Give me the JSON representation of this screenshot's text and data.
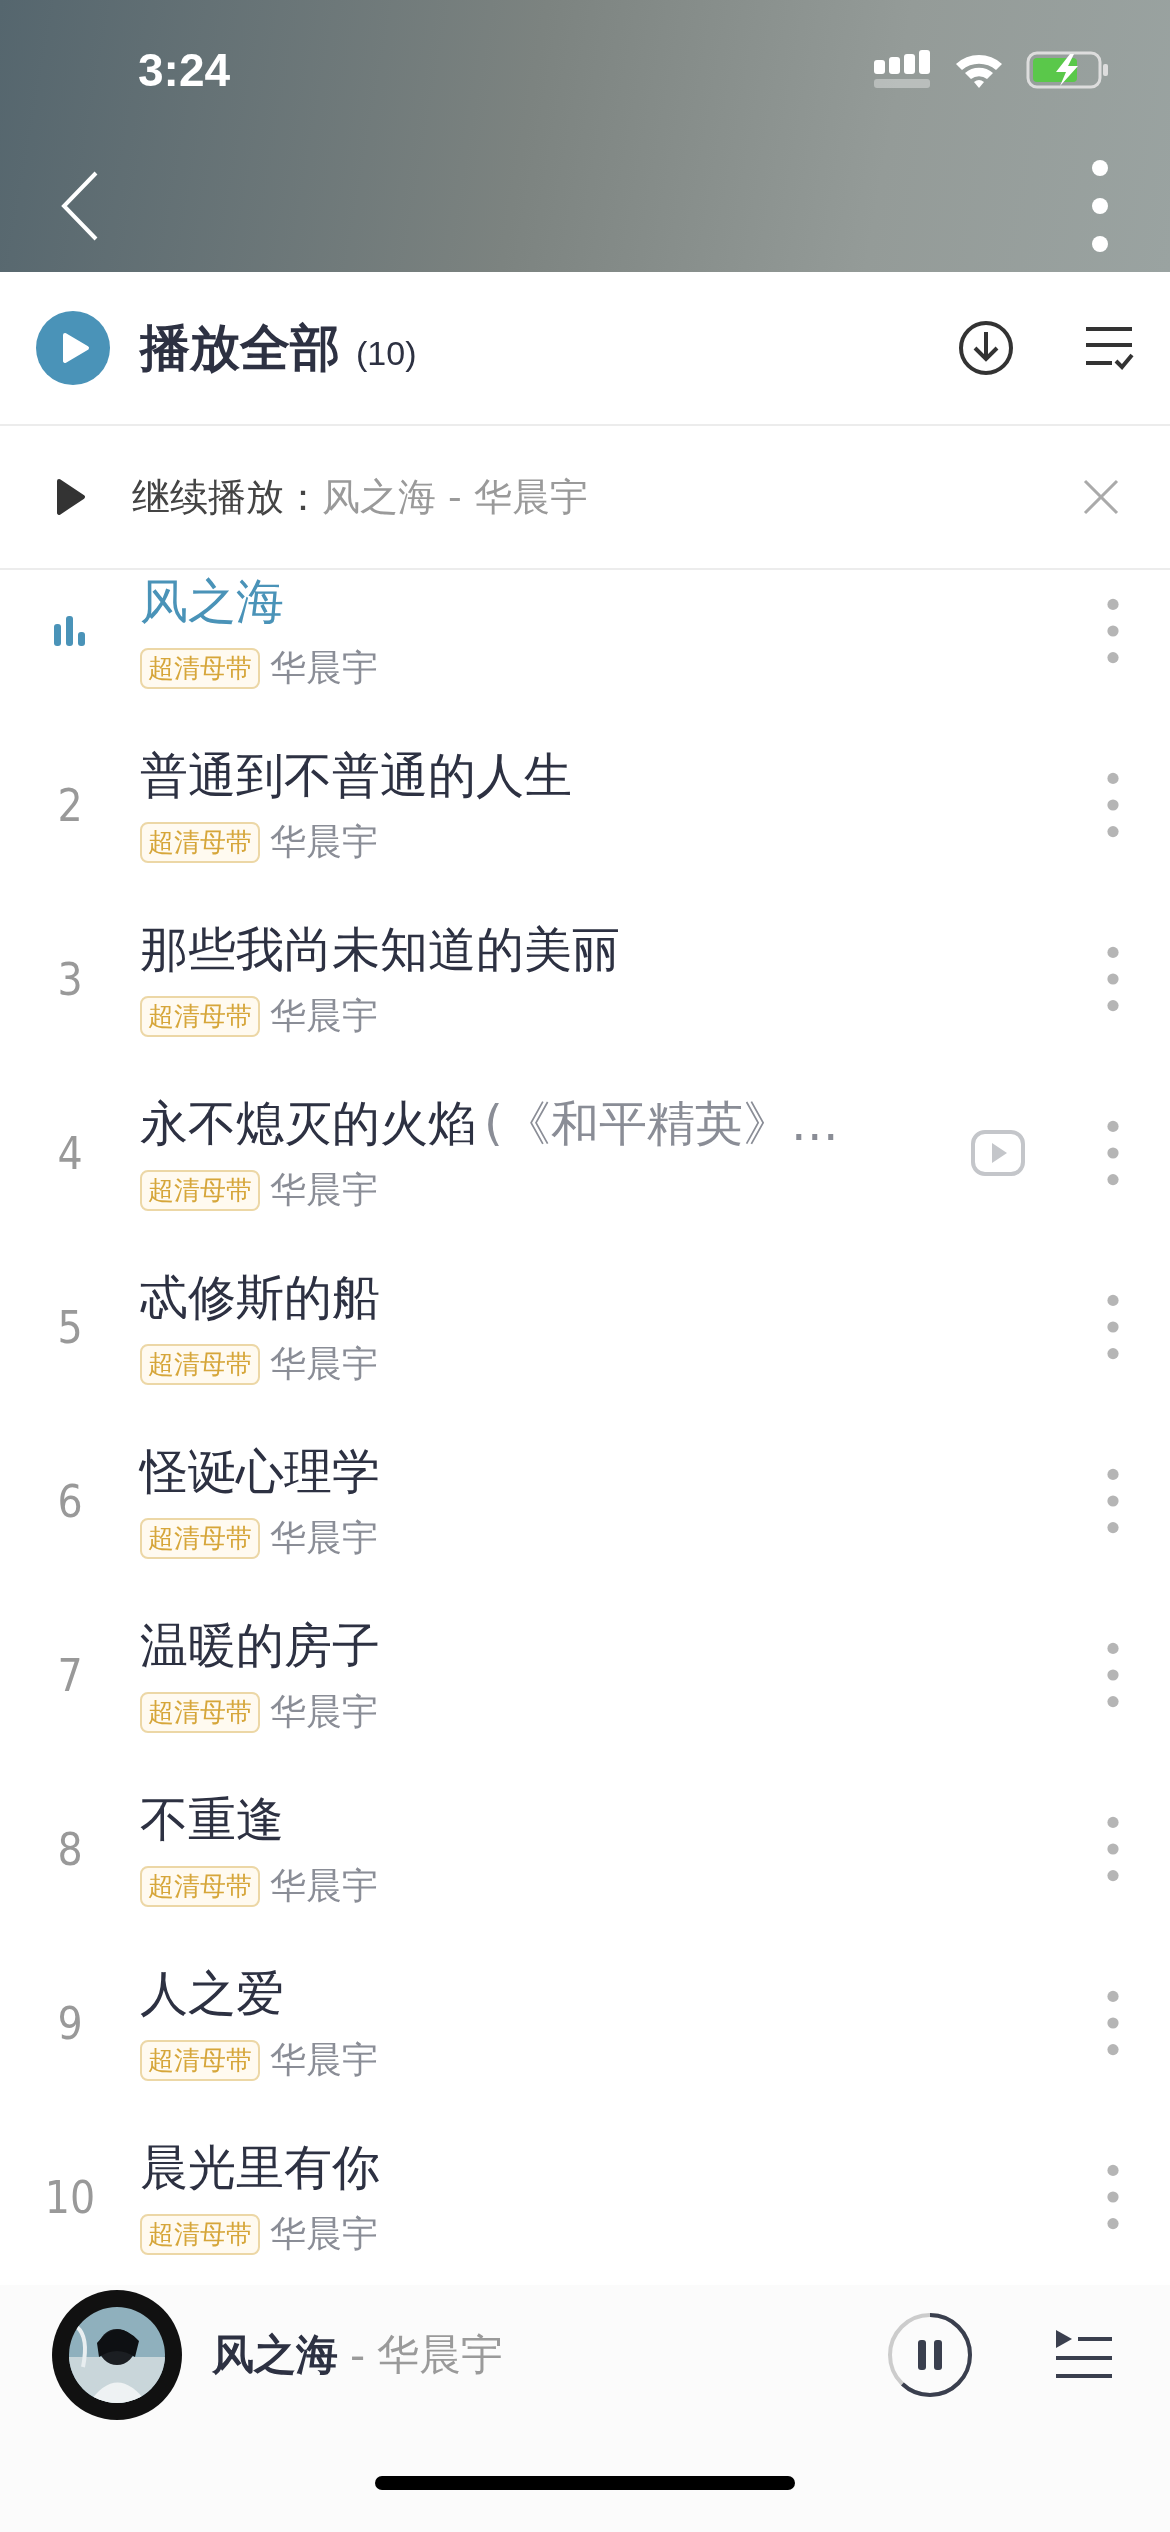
{
  "status_bar": {
    "time": "3:24"
  },
  "header": {
    "play_all": "播放全部",
    "count": "(10)"
  },
  "resume_bar": {
    "label": "继续播放：",
    "track": "风之海 - 华晨宇"
  },
  "songs": [
    {
      "title": "风之海",
      "tag": "超清母带",
      "artist": "华晨宇",
      "playing": true,
      "has_video": false
    },
    {
      "number": "2",
      "title": "普通到不普通的人生",
      "tag": "超清母带",
      "artist": "华晨宇",
      "playing": false,
      "has_video": false
    },
    {
      "number": "3",
      "title": "那些我尚未知道的美丽",
      "tag": "超清母带",
      "artist": "华晨宇",
      "playing": false,
      "has_video": false
    },
    {
      "number": "4",
      "title": "永不熄灭的火焰",
      "subtitle": "(《和平精英》…",
      "tag": "超清母带",
      "artist": "华晨宇",
      "playing": false,
      "has_video": true
    },
    {
      "number": "5",
      "title": "忒修斯的船",
      "tag": "超清母带",
      "artist": "华晨宇",
      "playing": false,
      "has_video": false
    },
    {
      "number": "6",
      "title": "怪诞心理学",
      "tag": "超清母带",
      "artist": "华晨宇",
      "playing": false,
      "has_video": false
    },
    {
      "number": "7",
      "title": "温暖的房子",
      "tag": "超清母带",
      "artist": "华晨宇",
      "playing": false,
      "has_video": false
    },
    {
      "number": "8",
      "title": "不重逢",
      "tag": "超清母带",
      "artist": "华晨宇",
      "playing": false,
      "has_video": false
    },
    {
      "number": "9",
      "title": "人之爱",
      "tag": "超清母带",
      "artist": "华晨宇",
      "playing": false,
      "has_video": false
    },
    {
      "number": "10",
      "title": "晨光里有你",
      "tag": "超清母带",
      "artist": "华晨宇",
      "playing": false,
      "has_video": false
    }
  ],
  "player": {
    "title": "风之海",
    "separator": "-",
    "artist": "华晨宇",
    "playing": true
  }
}
